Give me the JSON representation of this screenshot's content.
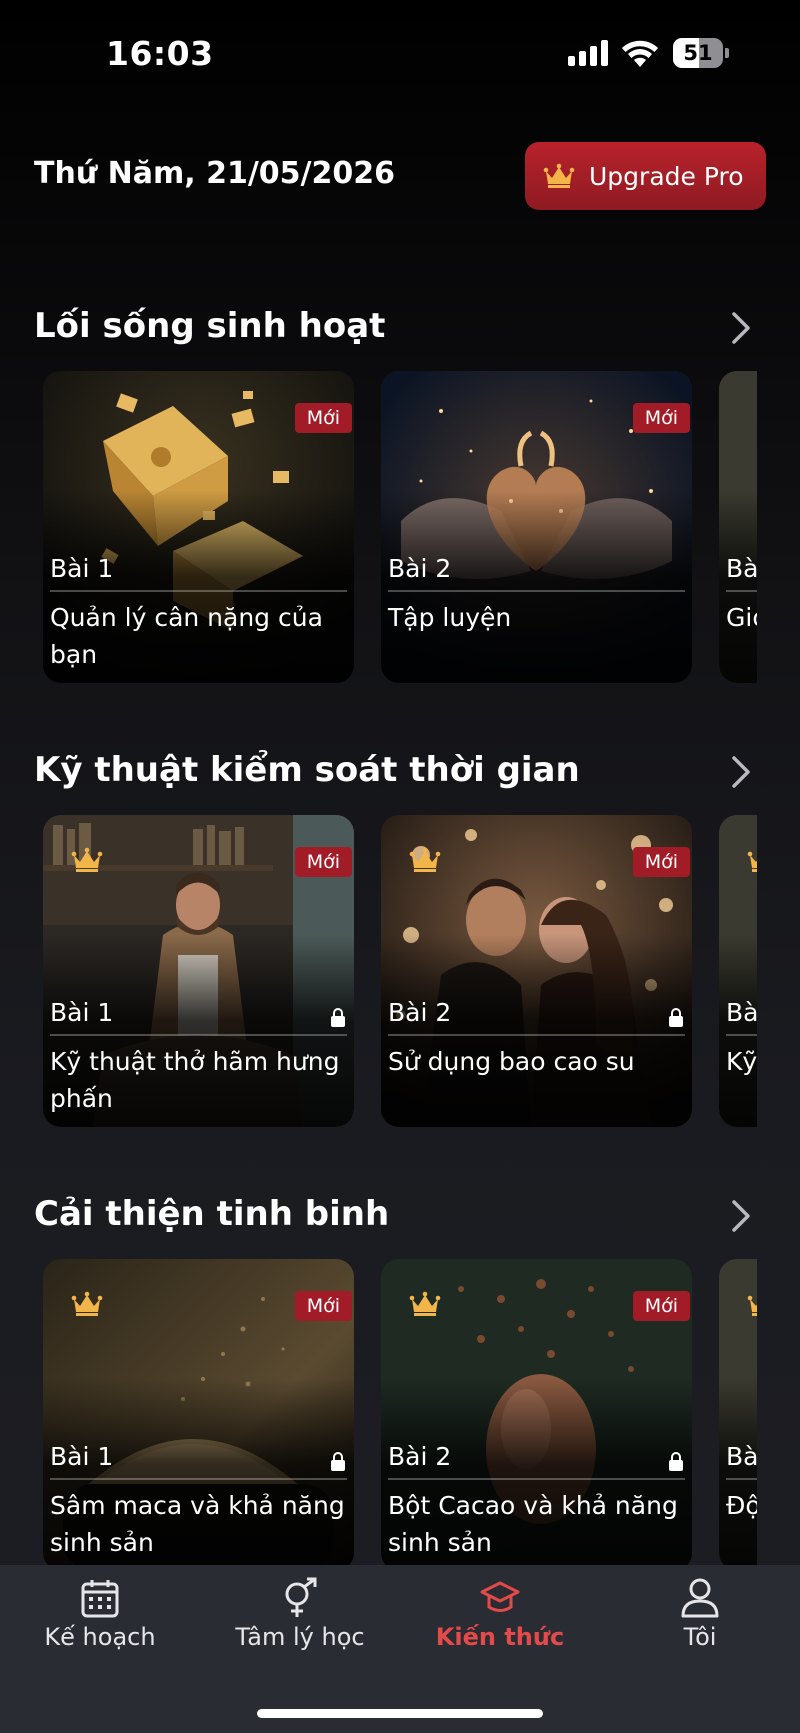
{
  "status_bar": {
    "time": "16:03",
    "battery": "51",
    "battery_level": 0.51
  },
  "header": {
    "date": "Thứ Năm, 21/05/2026",
    "upgrade_label": "Upgrade Pro"
  },
  "colors": {
    "accent_red": "#b8222b",
    "active_tab": "#e34a4a",
    "crown_gold": "#f2b54a"
  },
  "sections": [
    {
      "title": "Lối sống sinh hoạt",
      "cards": [
        {
          "lesson": "Bài 1",
          "title": "Quản lý cân nặng của bạn",
          "badge": "Mới",
          "locked": false,
          "premium": false,
          "image": "cheese"
        },
        {
          "lesson": "Bài 2",
          "title": "Tập luyện",
          "badge": "Mới",
          "locked": false,
          "premium": false,
          "image": "heart-hands"
        },
        {
          "lesson": "Bà",
          "title": "Gio bạ",
          "badge": "",
          "locked": false,
          "premium": false,
          "image": "partial"
        }
      ]
    },
    {
      "title": "Kỹ thuật kiểm soát thời gian",
      "cards": [
        {
          "lesson": "Bài 1",
          "title": "Kỹ thuật thở hãm hưng phấn",
          "badge": "Mới",
          "locked": true,
          "premium": true,
          "image": "meditation"
        },
        {
          "lesson": "Bài 2",
          "title": "Sử dụng bao cao su",
          "badge": "Mới",
          "locked": true,
          "premium": true,
          "image": "couple"
        },
        {
          "lesson": "Bà",
          "title": "Kỹ kíc",
          "badge": "",
          "locked": false,
          "premium": true,
          "image": "partial"
        }
      ]
    },
    {
      "title": "Cải thiện tinh binh",
      "cards": [
        {
          "lesson": "Bài 1",
          "title": "Sâm maca và khả năng sinh sản",
          "badge": "Mới",
          "locked": true,
          "premium": true,
          "image": "powder"
        },
        {
          "lesson": "Bài 2",
          "title": "Bột Cacao và khả năng sinh sản",
          "badge": "Mới",
          "locked": true,
          "premium": true,
          "image": "cacao"
        },
        {
          "lesson": "Bà",
          "title": "Độ sin",
          "badge": "",
          "locked": false,
          "premium": true,
          "image": "partial"
        }
      ]
    }
  ],
  "tabs": [
    {
      "label": "Kế hoạch",
      "icon": "calendar-icon",
      "active": false
    },
    {
      "label": "Tâm lý học",
      "icon": "gender-icon",
      "active": false
    },
    {
      "label": "Kiến thức",
      "icon": "graduation-cap-icon",
      "active": true
    },
    {
      "label": "Tôi",
      "icon": "user-icon",
      "active": false
    }
  ]
}
